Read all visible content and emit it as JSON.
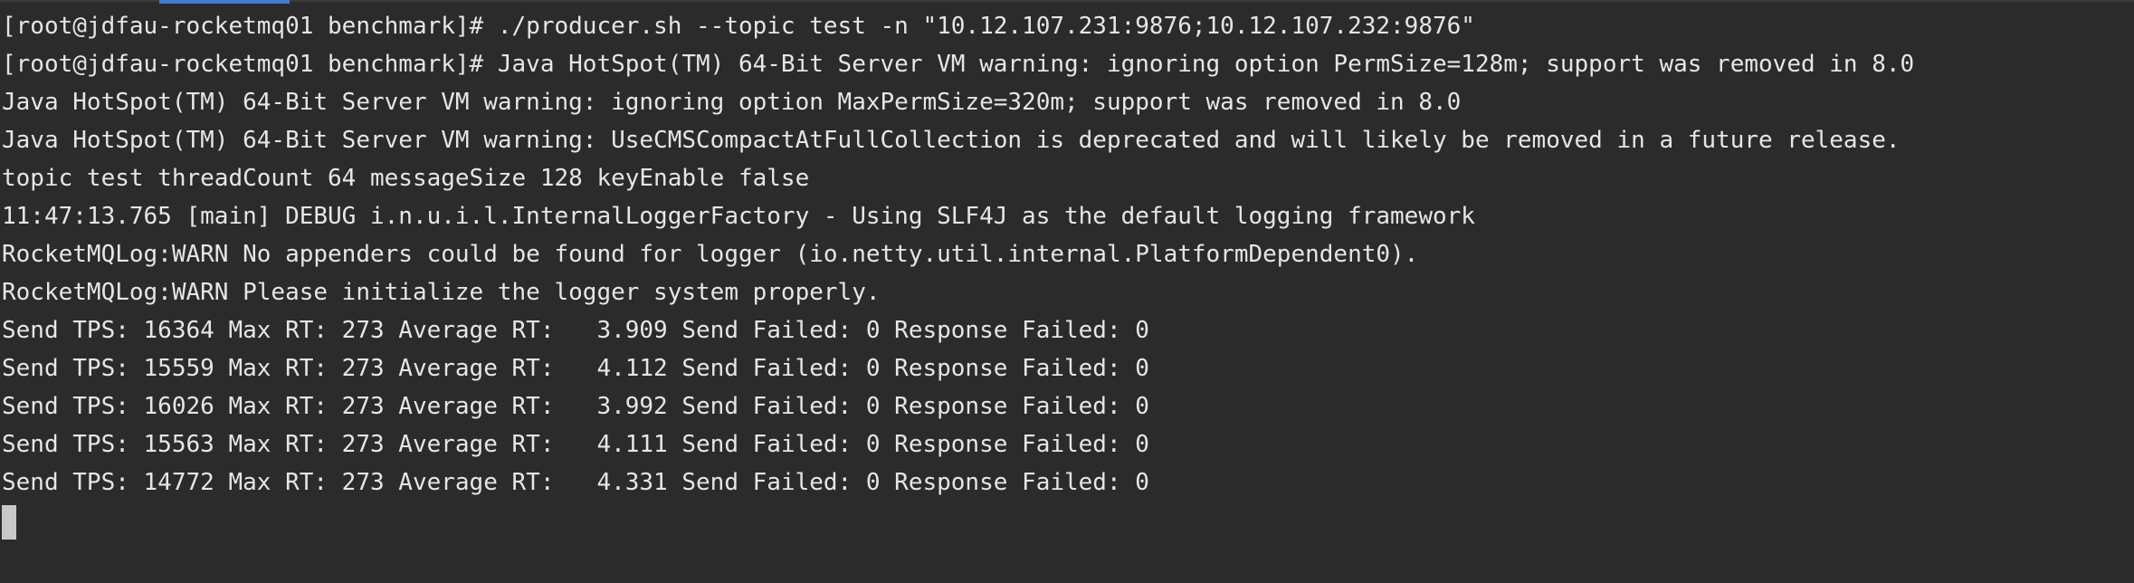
{
  "terminal": {
    "lines": [
      "[root@jdfau-rocketmq01 benchmark]# ./producer.sh --topic test -n \"10.12.107.231:9876;10.12.107.232:9876\"",
      "[root@jdfau-rocketmq01 benchmark]# Java HotSpot(TM) 64-Bit Server VM warning: ignoring option PermSize=128m; support was removed in 8.0",
      "Java HotSpot(TM) 64-Bit Server VM warning: ignoring option MaxPermSize=320m; support was removed in 8.0",
      "Java HotSpot(TM) 64-Bit Server VM warning: UseCMSCompactAtFullCollection is deprecated and will likely be removed in a future release.",
      "topic test threadCount 64 messageSize 128 keyEnable false",
      "11:47:13.765 [main] DEBUG i.n.u.i.l.InternalLoggerFactory - Using SLF4J as the default logging framework",
      "RocketMQLog:WARN No appenders could be found for logger (io.netty.util.internal.PlatformDependent0).",
      "RocketMQLog:WARN Please initialize the logger system properly.",
      "Send TPS: 16364 Max RT: 273 Average RT:   3.909 Send Failed: 0 Response Failed: 0",
      "Send TPS: 15559 Max RT: 273 Average RT:   4.112 Send Failed: 0 Response Failed: 0",
      "Send TPS: 16026 Max RT: 273 Average RT:   3.992 Send Failed: 0 Response Failed: 0",
      "Send TPS: 15563 Max RT: 273 Average RT:   4.111 Send Failed: 0 Response Failed: 0",
      "Send TPS: 14772 Max RT: 273 Average RT:   4.331 Send Failed: 0 Response Failed: 0"
    ]
  },
  "colors": {
    "background": "#2b2b2b",
    "text": "#e6e6e6",
    "cursor": "#c8c8c8",
    "tab_accent": "#3d7bd9"
  }
}
